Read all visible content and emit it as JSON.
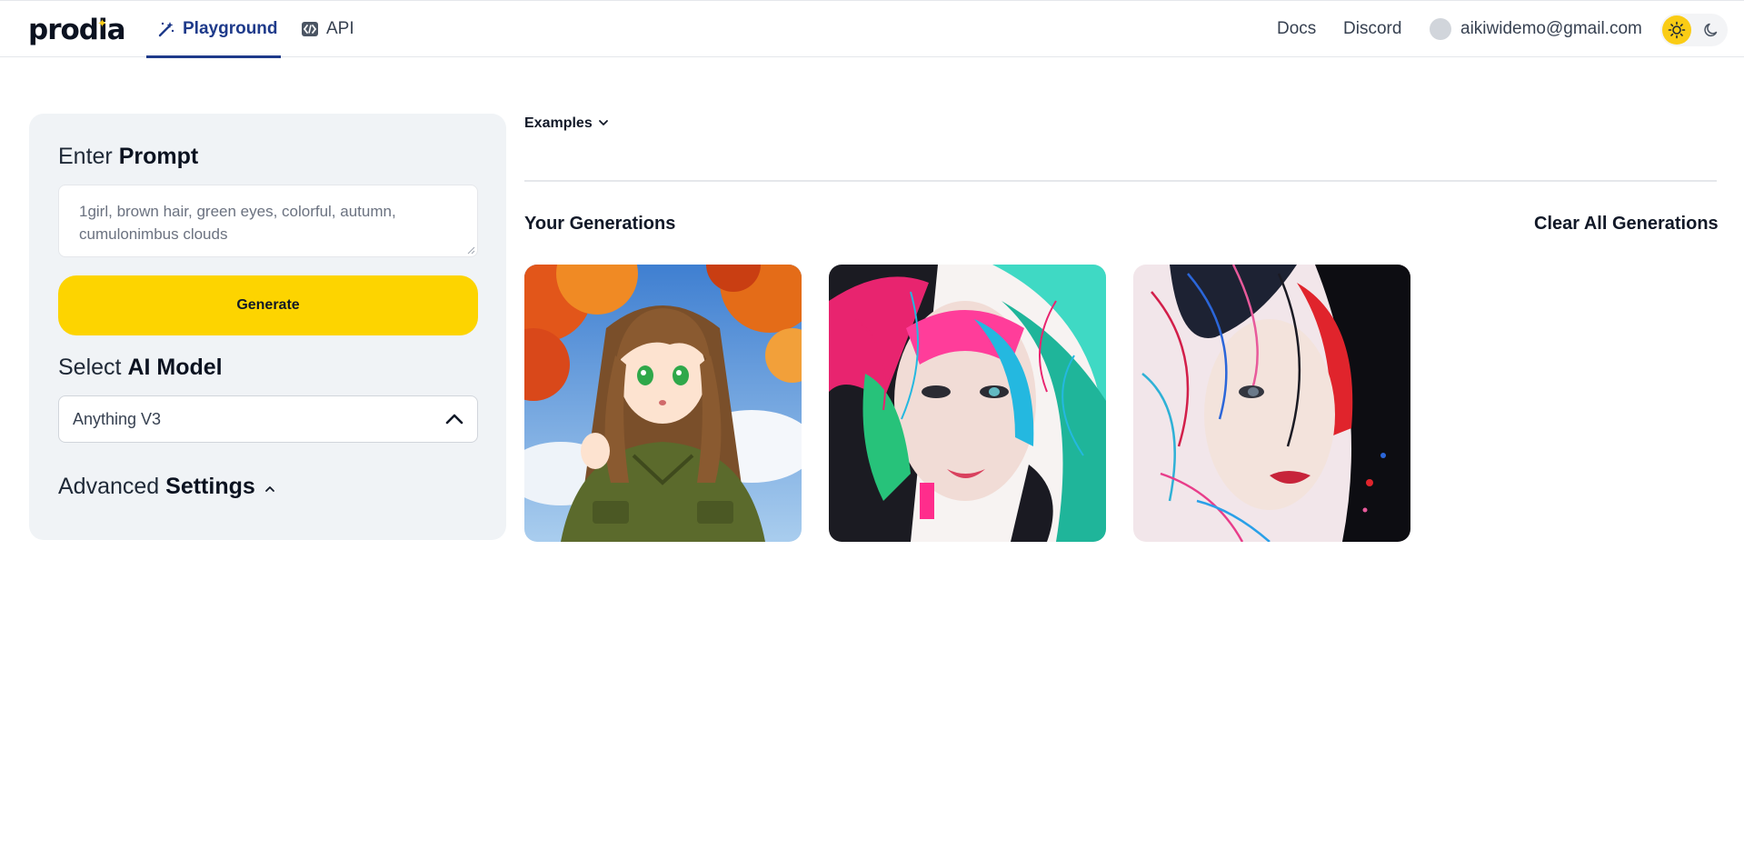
{
  "nav": {
    "logo": "prodia",
    "tabs": [
      {
        "label": "Playground",
        "icon": "magic-wand-icon"
      },
      {
        "label": "API",
        "icon": "code-icon"
      }
    ],
    "links": {
      "docs": "Docs",
      "discord": "Discord"
    },
    "user_email": "aikiwidemo@gmail.com",
    "theme": {
      "active": "light",
      "icons": [
        "sun-icon",
        "moon-icon"
      ]
    }
  },
  "prompt_panel": {
    "prompt_label_light": "Enter",
    "prompt_label_bold": "Prompt",
    "prompt_placeholder": "1girl, brown hair, green eyes, colorful, autumn, cumulonimbus clouds",
    "generate_label": "Generate",
    "model_label_light": "Select",
    "model_label_bold": "AI Model",
    "model_value": "Anything V3",
    "advanced_label_light": "Advanced",
    "advanced_label_bold": "Settings"
  },
  "main": {
    "examples_label": "Examples",
    "generations_title": "Your Generations",
    "clear_label": "Clear All Generations",
    "images": [
      {
        "subject": "anime girl with brown hair and green eyes, autumn leaves, clouds"
      },
      {
        "subject": "woman face with colorful paint splashes"
      },
      {
        "subject": "woman face with colorful ink splatter"
      }
    ]
  },
  "colors": {
    "accent_yellow": "#fdd400",
    "nav_active": "#1e3a8a",
    "panel_bg": "#f0f3f6"
  }
}
